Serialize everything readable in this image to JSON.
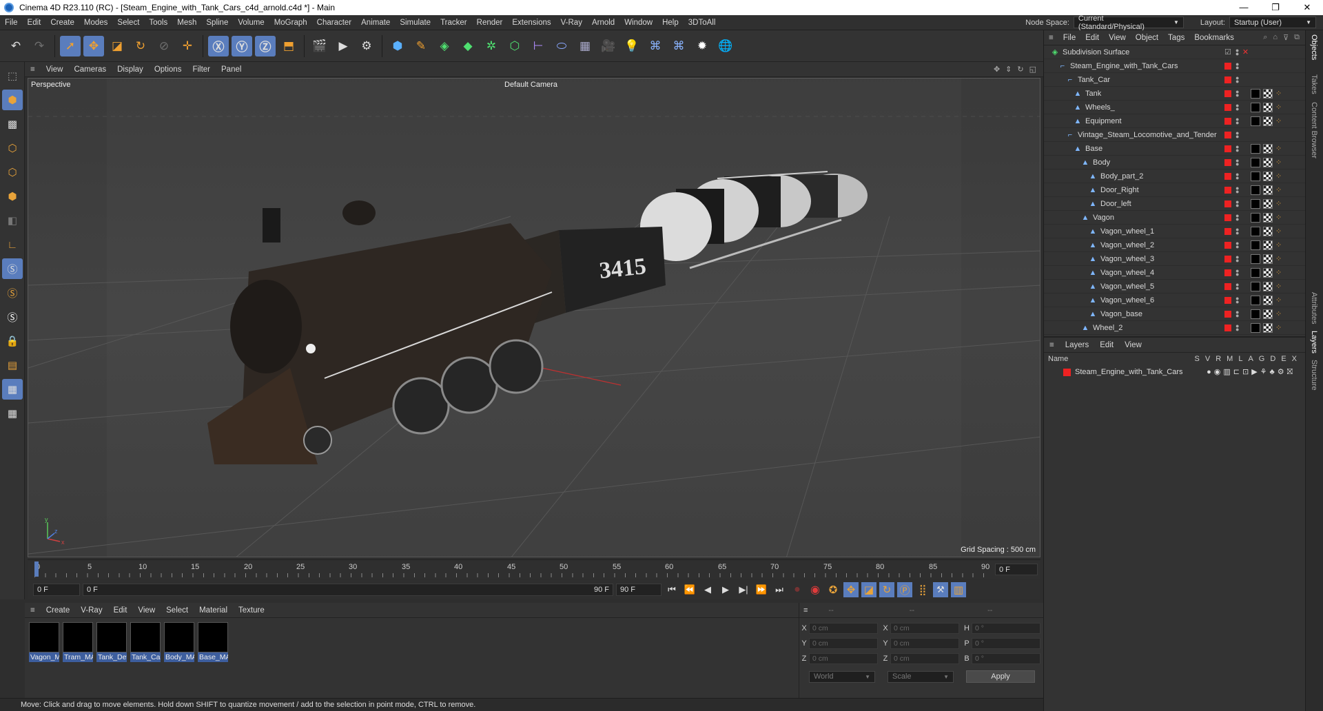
{
  "window": {
    "title": "Cinema 4D R23.110 (RC) - [Steam_Engine_with_Tank_Cars_c4d_arnold.c4d *] - Main"
  },
  "menubar": {
    "items": [
      "File",
      "Edit",
      "Create",
      "Modes",
      "Select",
      "Tools",
      "Mesh",
      "Spline",
      "Volume",
      "MoGraph",
      "Character",
      "Animate",
      "Simulate",
      "Tracker",
      "Render",
      "Extensions",
      "V-Ray",
      "Arnold",
      "Window",
      "Help",
      "3DToAll"
    ],
    "node_space_label": "Node Space:",
    "node_space_value": "Current (Standard/Physical)",
    "layout_label": "Layout:",
    "layout_value": "Startup (User)"
  },
  "viewport": {
    "menu": [
      "View",
      "Cameras",
      "Display",
      "Options",
      "Filter",
      "Panel"
    ],
    "label": "Perspective",
    "camera": "Default Camera",
    "grid_spacing": "Grid Spacing : 500 cm",
    "axis_y": "y",
    "axis_z": "z",
    "axis_x": "x",
    "loco_number": "3415"
  },
  "timeline": {
    "ticks": [
      "0",
      "5",
      "10",
      "15",
      "20",
      "25",
      "30",
      "35",
      "40",
      "45",
      "50",
      "55",
      "60",
      "65",
      "70",
      "75",
      "80",
      "85",
      "90"
    ],
    "current_frame": "0 F"
  },
  "transport": {
    "start": "0 F",
    "range_start": "0 F",
    "range_end": "90 F",
    "end": "90 F"
  },
  "materials": {
    "menu": [
      "Create",
      "V-Ray",
      "Edit",
      "View",
      "Select",
      "Material",
      "Texture"
    ],
    "items": [
      "Vagon_MAT",
      "Tram_MAT",
      "Tank_Det",
      "Tank_Car",
      "Body_MAT",
      "Base_MAT"
    ]
  },
  "coords": {
    "header": [
      "--",
      "--",
      "--"
    ],
    "rows": [
      {
        "a1": "X",
        "v1": "0 cm",
        "a2": "X",
        "v2": "0 cm",
        "a3": "H",
        "v3": "0 °"
      },
      {
        "a1": "Y",
        "v1": "0 cm",
        "a2": "Y",
        "v2": "0 cm",
        "a3": "P",
        "v3": "0 °"
      },
      {
        "a1": "Z",
        "v1": "0 cm",
        "a2": "Z",
        "v2": "0 cm",
        "a3": "B",
        "v3": "0 °"
      }
    ],
    "world": "World",
    "scale": "Scale",
    "apply": "Apply"
  },
  "status": "Move: Click and drag to move elements. Hold down SHIFT to quantize movement / add to the selection in point mode, CTRL to remove.",
  "objects": {
    "menu": [
      "File",
      "Edit",
      "View",
      "Object",
      "Tags",
      "Bookmarks"
    ],
    "rows": [
      {
        "name": "Subdivision Surface",
        "depth": 0,
        "tags": false
      },
      {
        "name": "Steam_Engine_with_Tank_Cars",
        "depth": 1,
        "tags": false
      },
      {
        "name": "Tank_Car",
        "depth": 2,
        "tags": false
      },
      {
        "name": "Tank",
        "depth": 3,
        "tags": true
      },
      {
        "name": "Wheels_",
        "depth": 3,
        "tags": true
      },
      {
        "name": "Equipment",
        "depth": 3,
        "tags": true
      },
      {
        "name": "Vintage_Steam_Locomotive_and_Tender",
        "depth": 2,
        "tags": false
      },
      {
        "name": "Base",
        "depth": 3,
        "tags": true
      },
      {
        "name": "Body",
        "depth": 4,
        "tags": true
      },
      {
        "name": "Body_part_2",
        "depth": 5,
        "tags": true
      },
      {
        "name": "Door_Right",
        "depth": 5,
        "tags": true
      },
      {
        "name": "Door_left",
        "depth": 5,
        "tags": true
      },
      {
        "name": "Vagon",
        "depth": 4,
        "tags": true
      },
      {
        "name": "Vagon_wheel_1",
        "depth": 5,
        "tags": true
      },
      {
        "name": "Vagon_wheel_2",
        "depth": 5,
        "tags": true
      },
      {
        "name": "Vagon_wheel_3",
        "depth": 5,
        "tags": true
      },
      {
        "name": "Vagon_wheel_4",
        "depth": 5,
        "tags": true
      },
      {
        "name": "Vagon_wheel_5",
        "depth": 5,
        "tags": true
      },
      {
        "name": "Vagon_wheel_6",
        "depth": 5,
        "tags": true
      },
      {
        "name": "Vagon_base",
        "depth": 5,
        "tags": true
      },
      {
        "name": "Wheel_2",
        "depth": 4,
        "tags": true
      }
    ]
  },
  "layers": {
    "menu": [
      "Layers",
      "Edit",
      "View"
    ],
    "name_col": "Name",
    "cols": [
      "S",
      "V",
      "R",
      "M",
      "L",
      "A",
      "G",
      "D",
      "E",
      "X"
    ],
    "row": "Steam_Engine_with_Tank_Cars"
  },
  "sidetabs": [
    "Objects",
    "Takes",
    "Content Browser",
    "Attributes",
    "Layers",
    "Structure"
  ]
}
